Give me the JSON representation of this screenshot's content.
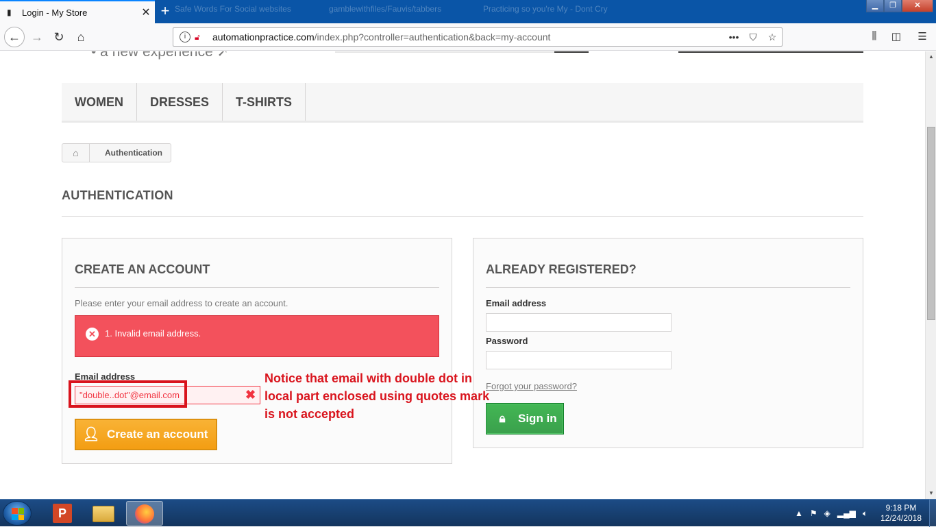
{
  "browser": {
    "active_tab_title": "Login - My Store",
    "background_tabs": [
      "Safe Words For Social websites",
      "gamblewithfiles/Fauvis/tabbers",
      "Practicing so you're My - Dont Cry"
    ],
    "url_domain": "automationpractice.com",
    "url_path": "/index.php?controller=authentication&back=my-account",
    "icons": [
      "back-icon",
      "forward-icon",
      "reload-icon",
      "home-icon",
      "info-icon",
      "insecure-lock-icon",
      "more-icon",
      "pocket-icon",
      "bookmark-star-icon",
      "library-icon",
      "sidebar-icon",
      "menu-icon"
    ]
  },
  "site": {
    "tagline": "• a new experience ➚",
    "menu": [
      "Women",
      "Dresses",
      "T-shirts"
    ],
    "breadcrumb": {
      "current": "Authentication"
    },
    "page_heading": "AUTHENTICATION"
  },
  "create_account": {
    "heading": "CREATE AN ACCOUNT",
    "description": "Please enter your email address to create an account.",
    "error_message": "1. Invalid email address.",
    "email_label": "Email address",
    "email_value": "\"double..dot\"@email.com",
    "button_label": "Create an account"
  },
  "login": {
    "heading": "ALREADY REGISTERED?",
    "email_label": "Email address",
    "email_value": "",
    "password_label": "Password",
    "password_value": "",
    "forgot_link": "Forgot your password?",
    "button_label": "Sign in"
  },
  "annotation": {
    "line1": "Notice that email with double dot in",
    "line2": "local part enclosed using quotes mark",
    "line3": "is not accepted",
    "color": "#d9141d"
  },
  "taskbar": {
    "apps": [
      "PowerPoint",
      "File Explorer",
      "Firefox"
    ],
    "time": "9:18 PM",
    "date": "12/24/2018"
  },
  "colors": {
    "error": "#f3515c",
    "create_button": "#f5a623",
    "signin_button": "#3aa04c",
    "browser_tabbar": "#0a55a7"
  }
}
